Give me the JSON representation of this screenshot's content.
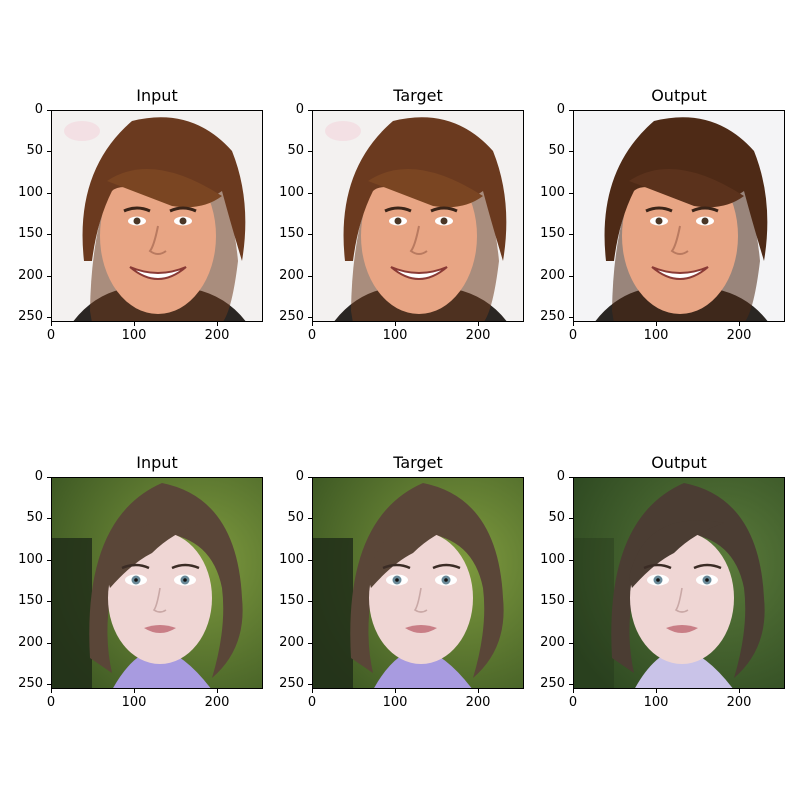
{
  "rows": [
    {
      "panels": [
        {
          "title": "Input",
          "scene": "boy",
          "variant": "input"
        },
        {
          "title": "Target",
          "scene": "boy",
          "variant": "target"
        },
        {
          "title": "Output",
          "scene": "boy",
          "variant": "output"
        }
      ]
    },
    {
      "panels": [
        {
          "title": "Input",
          "scene": "girl",
          "variant": "input"
        },
        {
          "title": "Target",
          "scene": "girl",
          "variant": "target"
        },
        {
          "title": "Output",
          "scene": "girl",
          "variant": "output"
        }
      ]
    }
  ],
  "axes": {
    "x_ticks": [
      "0",
      "100",
      "200"
    ],
    "x_tick_values": [
      0,
      100,
      200
    ],
    "y_ticks": [
      "0",
      "50",
      "100",
      "150",
      "200",
      "250"
    ],
    "y_tick_values": [
      0,
      50,
      100,
      150,
      200,
      250
    ],
    "extent": [
      0,
      256
    ]
  },
  "colors": {
    "boy_bg": "#f3f1f0",
    "boy_hair_input": "#6b3a1f",
    "boy_hair_output": "#4e2a16",
    "boy_skin": "#e8a584",
    "boy_shirt": "#2a2623",
    "girl_bg": "#3f5a24",
    "girl_bg_output": "#2f4a22",
    "girl_hair": "#5a4638",
    "girl_skin": "#efd6d4",
    "girl_top": "#a89be0",
    "girl_eyes": "#6a8a99"
  }
}
